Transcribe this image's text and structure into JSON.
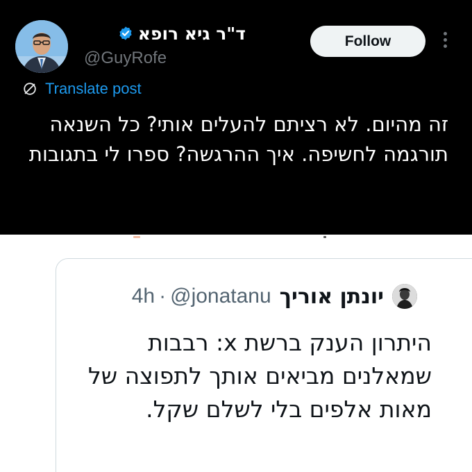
{
  "tweet": {
    "display_name": "ד\"ר גיא רופא",
    "handle": "@GuyRofe",
    "verified": true,
    "follow_label": "Follow",
    "translate_label": "Translate post",
    "text": "זה מהיום. לא רציתם להעלים אותי? כל השנאה תורגמה לחשיפה. איך ההרגשה? ספרו לי בתגובות"
  },
  "quoted": {
    "display_name": "יונתן אוריך",
    "handle": "@jonatanu",
    "separator": "·",
    "time": "4h",
    "text": "היתרון הענק ברשת x: רבבות שמאלנים מביאים אותך לתפוצה של מאות אלפים בלי לשלם שקל."
  },
  "colors": {
    "dark_bg": "#000000",
    "link_blue": "#1d9bf0",
    "muted_gray": "#71767b",
    "button_bg": "#eff3f4",
    "card_border": "#cfd9de"
  },
  "icons": [
    "verified-badge-icon",
    "more-options-icon",
    "translate-icon"
  ]
}
